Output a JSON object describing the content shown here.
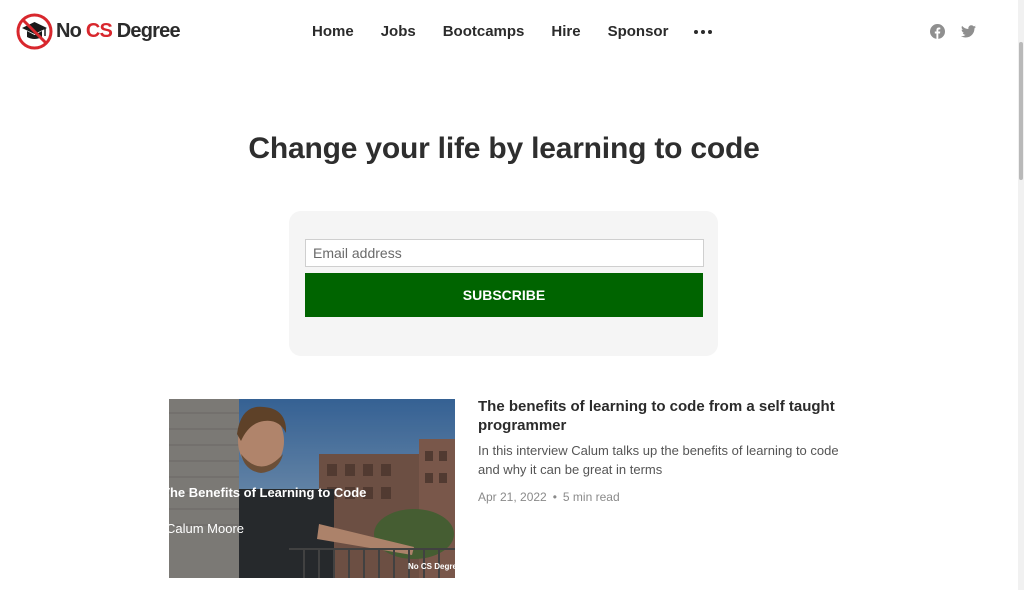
{
  "brand": {
    "name_prefix": "No",
    "name_accent": "CS",
    "name_suffix": "Degree",
    "accent_color": "#d8272d"
  },
  "nav": {
    "items": [
      "Home",
      "Jobs",
      "Bootcamps",
      "Hire",
      "Sponsor"
    ],
    "more_icon": "ellipsis-icon"
  },
  "social": {
    "icons": [
      "facebook-icon",
      "twitter-icon"
    ]
  },
  "hero": {
    "title": "Change your life by learning to code"
  },
  "subscribe": {
    "placeholder": "Email address",
    "button_label": "SUBSCRIBE",
    "button_color": "#006400"
  },
  "post": {
    "image_title": "The Benefits of Learning to Code",
    "image_author": "Calum Moore",
    "image_watermark": "No CS Degree",
    "title": "The benefits of learning to code from a self taught programmer",
    "excerpt": "In this interview Calum talks up the benefits of learning to code and why it can be great in terms",
    "date": "Apr 21, 2022",
    "read_time": "5 min read"
  }
}
